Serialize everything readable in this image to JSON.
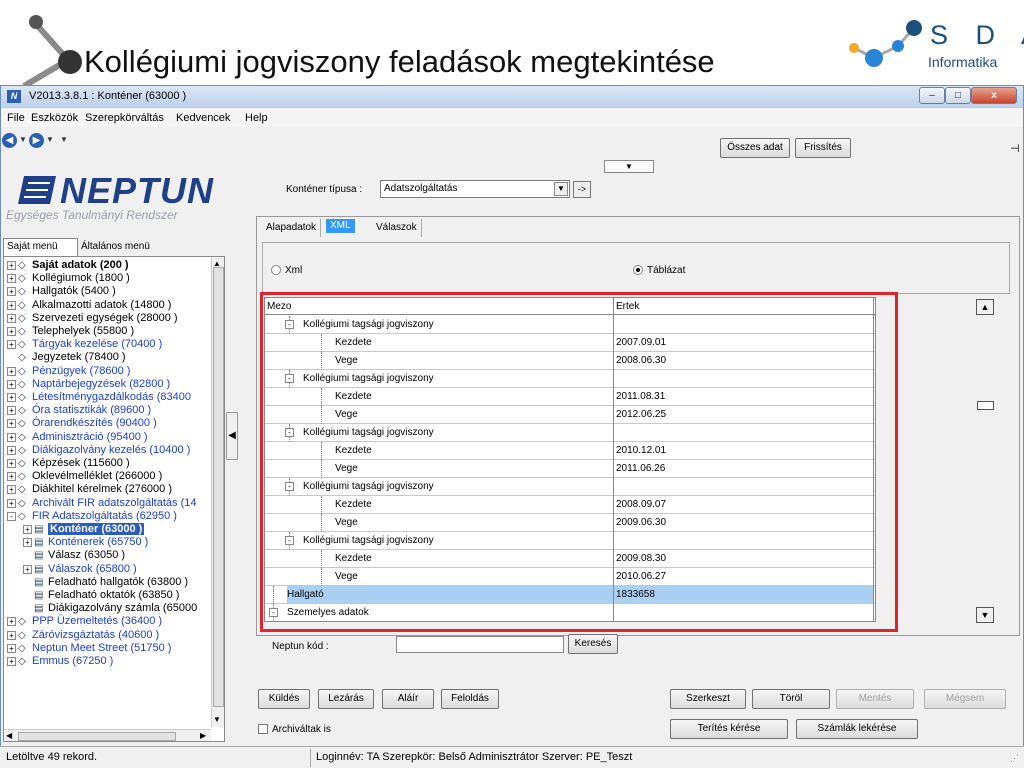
{
  "slide": {
    "title": "Kollégiumi jogviszony feladások megtekintése",
    "logo_letters": "S D A",
    "logo_sub": "Informatika"
  },
  "window": {
    "title": "V2013.3.8.1 : Konténer (63000 )",
    "min": "–",
    "max": "□",
    "close": "x"
  },
  "menu": [
    "File",
    "Eszközök",
    "Szerepkörváltás",
    "Kedvencek",
    "Help"
  ],
  "brand": {
    "name": "NEPTUN",
    "subtitle": "Egységes Tanulmányi Rendszer"
  },
  "left_tabs": [
    "Saját menü",
    "Általános menü"
  ],
  "tree": [
    {
      "label": "Saját adatok (200 )",
      "style": "bold",
      "level": 0,
      "box": "+"
    },
    {
      "label": "Kollégiumok (1800 )",
      "style": "",
      "level": 0,
      "box": "+"
    },
    {
      "label": "Hallgatók (5400 )",
      "style": "",
      "level": 0,
      "box": "+"
    },
    {
      "label": "Alkalmazotti adatok (14800 )",
      "style": "",
      "level": 0,
      "box": "+"
    },
    {
      "label": "Szervezeti egységek (28000 )",
      "style": "",
      "level": 0,
      "box": "+"
    },
    {
      "label": "Telephelyek (55800 )",
      "style": "",
      "level": 0,
      "box": "+"
    },
    {
      "label": "Tárgyak kezelése (70400 )",
      "style": "blue",
      "level": 0,
      "box": "+"
    },
    {
      "label": "Jegyzetek (78400 )",
      "style": "",
      "level": 0,
      "box": ""
    },
    {
      "label": "Pénzügyek (78600 )",
      "style": "blue",
      "level": 0,
      "box": "+"
    },
    {
      "label": "Naptárbejegyzések (82800 )",
      "style": "blue",
      "level": 0,
      "box": "+"
    },
    {
      "label": "Létesítménygazdálkodás (83400",
      "style": "blue",
      "level": 0,
      "box": "+"
    },
    {
      "label": "Óra statisztikák (89600 )",
      "style": "blue",
      "level": 0,
      "box": "+"
    },
    {
      "label": "Órarendkészítés (90400 )",
      "style": "blue",
      "level": 0,
      "box": "+"
    },
    {
      "label": "Adminisztráció (95400 )",
      "style": "blue",
      "level": 0,
      "box": "+"
    },
    {
      "label": "Diákigazolvány kezelés (10400 )",
      "style": "blue",
      "level": 0,
      "box": "+"
    },
    {
      "label": "Képzések (115600 )",
      "style": "",
      "level": 0,
      "box": "+"
    },
    {
      "label": "Oklevélmelléklet (266000 )",
      "style": "",
      "level": 0,
      "box": "+"
    },
    {
      "label": "Diákhitel kérelmek (276000 )",
      "style": "",
      "level": 0,
      "box": "+"
    },
    {
      "label": "Archivált FIR adatszolgáltatás (14",
      "style": "blue",
      "level": 0,
      "box": "+"
    },
    {
      "label": "FIR Adatszolgáltatás (62950 )",
      "style": "blue",
      "level": 0,
      "box": "-"
    },
    {
      "label": "Konténer (63000 )",
      "style": "sel",
      "level": 1,
      "box": "+"
    },
    {
      "label": "Konténerek (65750 )",
      "style": "blue",
      "level": 1,
      "box": "+"
    },
    {
      "label": "Válasz (63050 )",
      "style": "",
      "level": 1,
      "box": ""
    },
    {
      "label": "Válaszok (65800 )",
      "style": "blue",
      "level": 1,
      "box": "+"
    },
    {
      "label": "Feladható hallgatók (63800 )",
      "style": "",
      "level": 1,
      "box": ""
    },
    {
      "label": "Feladható oktatók (63850 )",
      "style": "",
      "level": 1,
      "box": ""
    },
    {
      "label": "Diákigazolvány számla (65000",
      "style": "",
      "level": 1,
      "box": ""
    },
    {
      "label": "PPP Üzemeltetés (36400 )",
      "style": "blue",
      "level": 0,
      "box": "+"
    },
    {
      "label": "Záróvizsgáztatás (40600 )",
      "style": "blue",
      "level": 0,
      "box": "+"
    },
    {
      "label": "Neptun Meet Street (51750 )",
      "style": "blue",
      "level": 0,
      "box": "+"
    },
    {
      "label": "Emmus (67250 )",
      "style": "blue",
      "level": 0,
      "box": "+"
    }
  ],
  "top_buttons": {
    "osszes": "Összes adat",
    "frissites": "Frissítés"
  },
  "kontener": {
    "label": "Konténer típusa :",
    "value": "Adatszolgáltatás",
    "go": "->"
  },
  "tabs": [
    "Alapadatok",
    "XML",
    "Válaszok"
  ],
  "radios": {
    "xml": "Xml",
    "tablazat": "Táblázat"
  },
  "grid": {
    "headers": [
      "Mezo",
      "Ertek"
    ],
    "rows": [
      {
        "label": "Kollégiumi tagsági jogviszony",
        "value": "",
        "level": 1,
        "box": "-"
      },
      {
        "label": "Kezdete",
        "value": "2007.09.01",
        "level": 2,
        "box": ""
      },
      {
        "label": "Vege",
        "value": "2008.06.30",
        "level": 2,
        "box": ""
      },
      {
        "label": "Kollégiumi tagsági jogviszony",
        "value": "",
        "level": 1,
        "box": "-"
      },
      {
        "label": "Kezdete",
        "value": "2011.08.31",
        "level": 2,
        "box": ""
      },
      {
        "label": "Vege",
        "value": "2012.06.25",
        "level": 2,
        "box": ""
      },
      {
        "label": "Kollégiumi tagsági jogviszony",
        "value": "",
        "level": 1,
        "box": "-"
      },
      {
        "label": "Kezdete",
        "value": "2010.12.01",
        "level": 2,
        "box": ""
      },
      {
        "label": "Vege",
        "value": "2011.06.26",
        "level": 2,
        "box": ""
      },
      {
        "label": "Kollégiumi tagsági jogviszony",
        "value": "",
        "level": 1,
        "box": "-"
      },
      {
        "label": "Kezdete",
        "value": "2008.09.07",
        "level": 2,
        "box": ""
      },
      {
        "label": "Vege",
        "value": "2009.06.30",
        "level": 2,
        "box": ""
      },
      {
        "label": "Kollégiumi tagsági jogviszony",
        "value": "",
        "level": 1,
        "box": "-"
      },
      {
        "label": "Kezdete",
        "value": "2009.08.30",
        "level": 2,
        "box": ""
      },
      {
        "label": "Vege",
        "value": "2010.06.27",
        "level": 2,
        "box": ""
      },
      {
        "label": "Hallgató",
        "value": "1833658",
        "level": 0,
        "box": "",
        "selected": true
      },
      {
        "label": "Szemelyes adatok",
        "value": "",
        "level": 0,
        "box": "-"
      }
    ]
  },
  "search": {
    "label": "Neptun kód :",
    "button": "Keresés"
  },
  "bottom_buttons": {
    "kuldes": "Küldés",
    "lezaras": "Lezárás",
    "alair": "Aláír",
    "feloldas": "Feloldás",
    "szerkeszt": "Szerkeszt",
    "torol": "Töröl",
    "mentes": "Mentés",
    "megsem": "Mégsem",
    "terites": "Terítés kérése",
    "szamlak": "Számlák lekérése"
  },
  "archivaltak": "Archiváltak is",
  "status": {
    "records": "Letöltve 49 rekord.",
    "session": "Loginnév: TA  Szerepkör: Belső Adminisztrátor  Szerver: PE_Teszt"
  },
  "colors": {
    "accent_red": "#e2222c",
    "selection_blue": "#2b5cc0",
    "tab_blue": "#3399ff",
    "neptun_navy": "#1f3f86"
  }
}
